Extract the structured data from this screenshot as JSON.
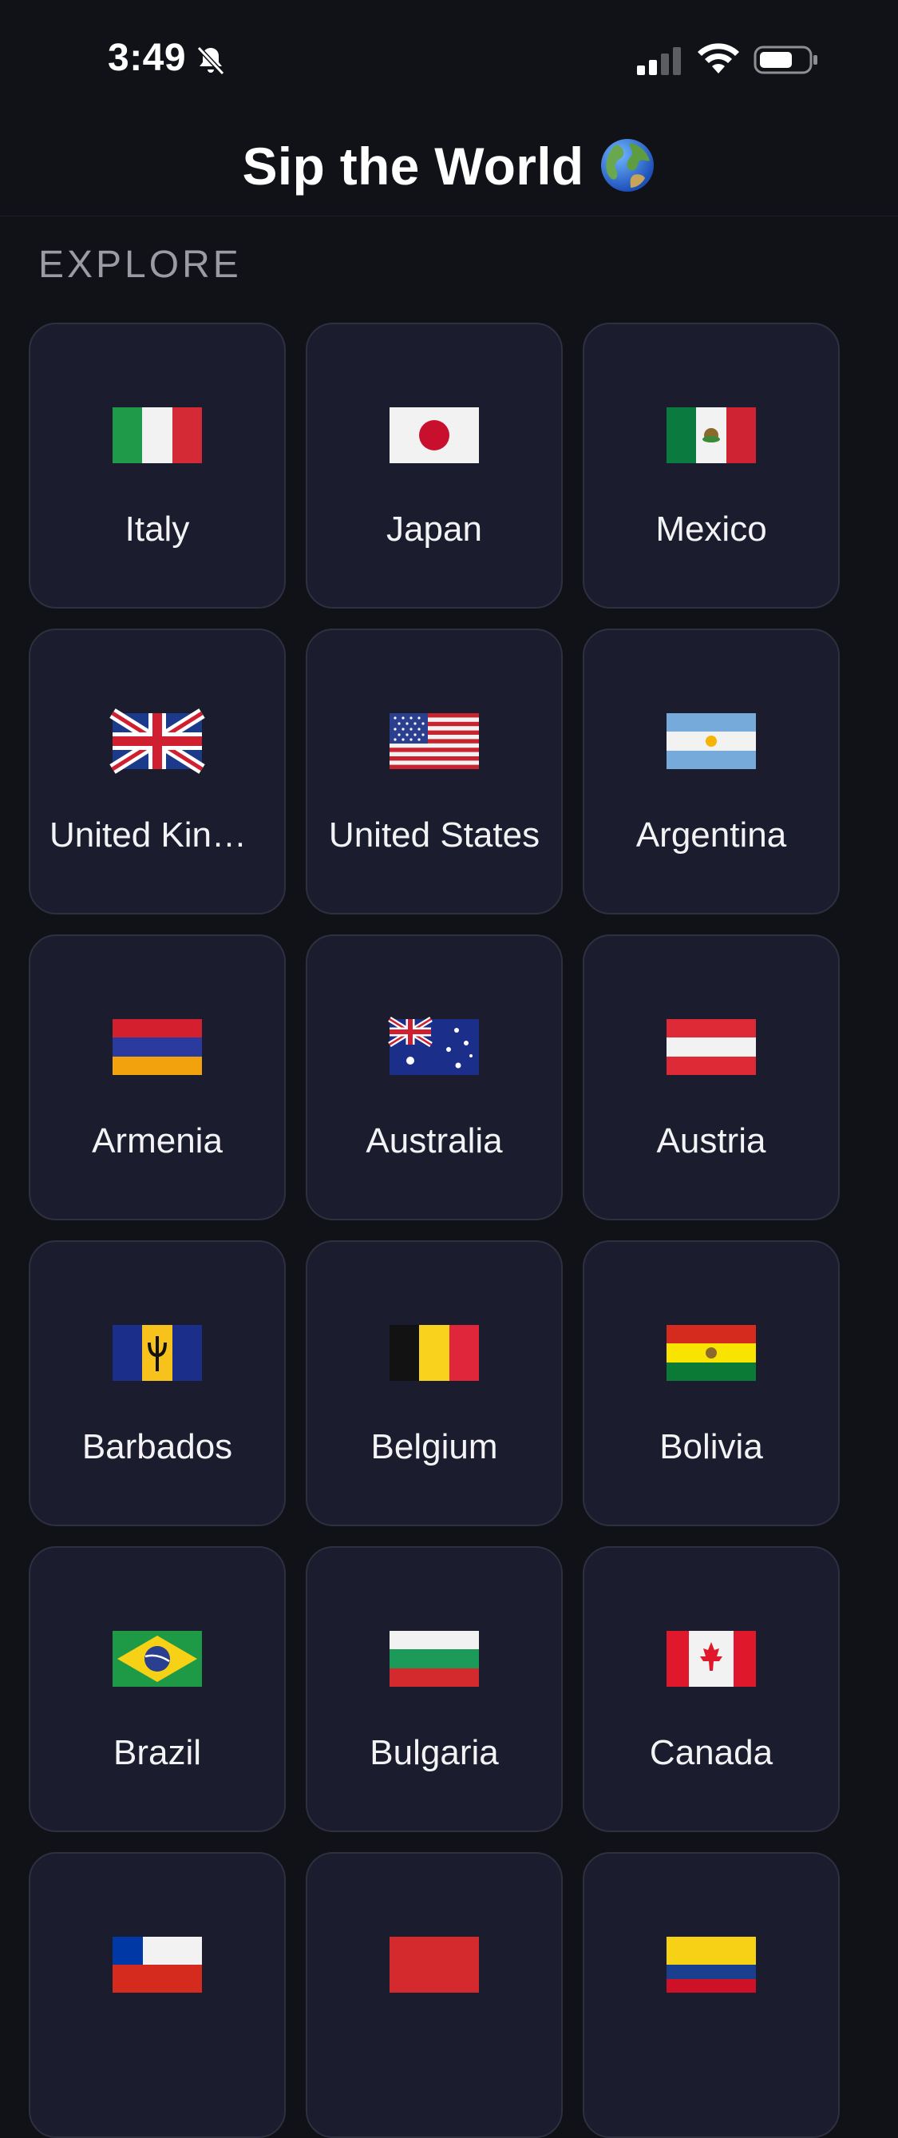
{
  "status": {
    "time": "3:49"
  },
  "nav": {
    "title": "Sip the World"
  },
  "section": {
    "label": "EXPLORE"
  },
  "countries": [
    {
      "name": "Italy",
      "flag": "it"
    },
    {
      "name": "Japan",
      "flag": "jp"
    },
    {
      "name": "Mexico",
      "flag": "mx"
    },
    {
      "name": "United Kingdom",
      "flag": "gb"
    },
    {
      "name": "United States",
      "flag": "us"
    },
    {
      "name": "Argentina",
      "flag": "ar"
    },
    {
      "name": "Armenia",
      "flag": "am"
    },
    {
      "name": "Australia",
      "flag": "au"
    },
    {
      "name": "Austria",
      "flag": "at"
    },
    {
      "name": "Barbados",
      "flag": "bb"
    },
    {
      "name": "Belgium",
      "flag": "be"
    },
    {
      "name": "Bolivia",
      "flag": "bo"
    },
    {
      "name": "Brazil",
      "flag": "br"
    },
    {
      "name": "Bulgaria",
      "flag": "bg"
    },
    {
      "name": "Canada",
      "flag": "ca"
    },
    {
      "name": "",
      "flag": "cl"
    },
    {
      "name": "",
      "flag": "xx"
    },
    {
      "name": "",
      "flag": "co"
    }
  ],
  "colors": {
    "background": "#111218",
    "card": "#1b1c2d",
    "card_border": "#2e3040",
    "label": "#9a9ba3"
  }
}
